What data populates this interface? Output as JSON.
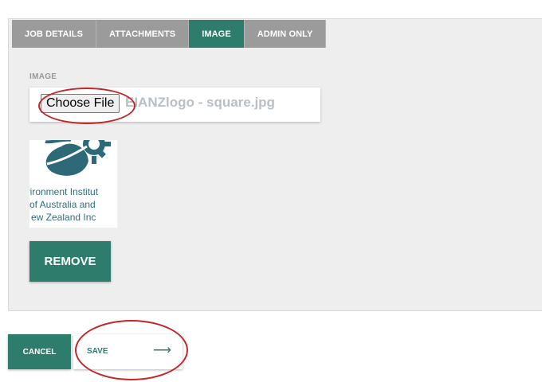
{
  "tabs": [
    {
      "label": "JOB DETAILS",
      "active": false
    },
    {
      "label": "ATTACHMENTS",
      "active": false
    },
    {
      "label": "IMAGE",
      "active": true
    },
    {
      "label": "ADMIN ONLY",
      "active": false
    }
  ],
  "image_field": {
    "label": "IMAGE",
    "choose_button": "Choose File",
    "file_name": "EIANZlogo - square.jpg"
  },
  "logo": {
    "line1": "nvironment Institut",
    "line2": "of Australia and",
    "line3": "ew Zealand Inc"
  },
  "buttons": {
    "remove": "REMOVE",
    "cancel": "CANCEL",
    "save": "SAVE",
    "save_arrow": "⟶"
  },
  "colors": {
    "accent": "#2e7d6c",
    "tab_inactive": "#9b9b9b",
    "annotation": "#c0282a"
  }
}
